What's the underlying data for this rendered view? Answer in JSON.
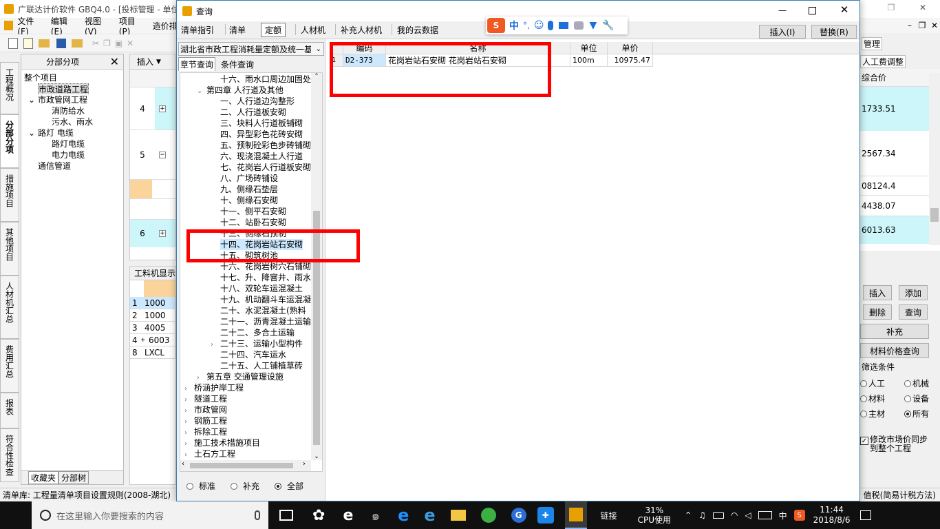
{
  "bg_app": {
    "title": "广联达计价软件 GBQ4.0 - [投标管理 - 单位",
    "menu": [
      "文件(F)",
      "编辑(E)",
      "视图(V)",
      "项目(P)",
      "造价排"
    ],
    "toolbar_insert": "插入",
    "sidebar_tabs": [
      "工程概况",
      "分部分项",
      "措施项目",
      "其他项目",
      "人材机汇总",
      "费用汇总",
      "报表",
      "符合性检查"
    ],
    "left_panel": {
      "title": "分部分项",
      "tree": [
        "整个项目",
        "市政道路工程",
        "市政管网工程",
        "消防给水",
        "污水、雨水",
        "路灯 电缆",
        "路灯电缆",
        "电力电缆",
        "通信管道"
      ],
      "tabs": [
        "收藏夹",
        "分部树"
      ]
    },
    "main_rows": [
      "4",
      "5",
      "6"
    ],
    "bottom_tab": "工料机显示",
    "bottom_rows": [
      {
        "n": "1",
        "code": "1000"
      },
      {
        "n": "2",
        "code": "1000"
      },
      {
        "n": "3",
        "code": "4005"
      },
      {
        "n": "4",
        "code": "6003"
      },
      {
        "n": "8",
        "code": "LXCL"
      }
    ],
    "right_panel": {
      "label_manage": "管理",
      "label_labor": "人工费调整",
      "col_header": "综合价",
      "values": [
        "1733.51",
        "2567.34",
        "08124.4",
        "4438.07",
        "6013.63"
      ],
      "buttons": [
        "插入",
        "添加",
        "删除",
        "查询",
        "补充",
        "材料价格查询"
      ],
      "filter_title": "筛选条件",
      "filters": [
        "人工",
        "机械",
        "材料",
        "设备",
        "主材",
        "所有"
      ],
      "sync_label": "修改市场价同步到整个工程"
    },
    "status_left": "清单库: 工程量清单项目设置规则(2008-湖北)",
    "status_right": "值税(简易计税方法)"
  },
  "dialog": {
    "title": "查询",
    "tabs": [
      "清单指引",
      "清单",
      "定额",
      "人材机",
      "补充人材机",
      "我的云数据"
    ],
    "active_tab": "定额",
    "insert_btn": "插入(I)",
    "replace_btn": "替换(R)",
    "library": "湖北省市政工程消耗量定额及统一基",
    "sub_tabs": [
      "章节查询",
      "条件查询"
    ],
    "tree": [
      {
        "level": 2,
        "text": "十六、雨水口周边加固处",
        "arrow": ""
      },
      {
        "level": 1,
        "text": "第四章 人行道及其他",
        "arrow": "down"
      },
      {
        "level": 2,
        "text": "一、人行道边沟整形",
        "arrow": ""
      },
      {
        "level": 2,
        "text": "二、人行道板安砌",
        "arrow": ""
      },
      {
        "level": 2,
        "text": "三、块料人行道板铺砌",
        "arrow": ""
      },
      {
        "level": 2,
        "text": "四、异型彩色花砖安砌",
        "arrow": ""
      },
      {
        "level": 2,
        "text": "五、预制砼彩色步砖铺砌",
        "arrow": ""
      },
      {
        "level": 2,
        "text": "六、现浇混凝土人行道",
        "arrow": ""
      },
      {
        "level": 2,
        "text": "七、花岗岩人行道板安砌",
        "arrow": ""
      },
      {
        "level": 2,
        "text": "八、广场砖铺设",
        "arrow": ""
      },
      {
        "level": 2,
        "text": "九、侧缘石垫层",
        "arrow": ""
      },
      {
        "level": 2,
        "text": "十、侧缘石安砌",
        "arrow": ""
      },
      {
        "level": 2,
        "text": "十一、侧平石安砌",
        "arrow": ""
      },
      {
        "level": 2,
        "text": "十二、站卧石安砌",
        "arrow": ""
      },
      {
        "level": 2,
        "text": "十三、侧缘石预制",
        "arrow": ""
      },
      {
        "level": 2,
        "text": "十四、花岗岩站石安砌",
        "arrow": "",
        "selected": true
      },
      {
        "level": 2,
        "text": "十五、砌筑树池",
        "arrow": ""
      },
      {
        "level": 2,
        "text": "十六、花岗岩树穴石铺砌",
        "arrow": ""
      },
      {
        "level": 2,
        "text": "十七、升、降窨井、雨水",
        "arrow": ""
      },
      {
        "level": 2,
        "text": "十八、双轮车运混凝土",
        "arrow": ""
      },
      {
        "level": 2,
        "text": "十九、机动翻斗车运混凝",
        "arrow": ""
      },
      {
        "level": 2,
        "text": "二十、水泥混凝土(熟料",
        "arrow": ""
      },
      {
        "level": 2,
        "text": "二十一、沥青混凝土运输",
        "arrow": ""
      },
      {
        "level": 2,
        "text": "二十二、多合土运输",
        "arrow": ""
      },
      {
        "level": 2,
        "text": "二十三、运输小型构件",
        "arrow": "right"
      },
      {
        "level": 2,
        "text": "二十四、汽车运水",
        "arrow": ""
      },
      {
        "level": 2,
        "text": "二十五、人工铺植草砖",
        "arrow": ""
      },
      {
        "level": 1,
        "text": "第五章 交通管理设施",
        "arrow": "right"
      },
      {
        "level": 0,
        "text": "桥涵护岸工程",
        "arrow": "right"
      },
      {
        "level": 0,
        "text": "隧道工程",
        "arrow": "right"
      },
      {
        "level": 0,
        "text": "市政管网",
        "arrow": "right"
      },
      {
        "level": 0,
        "text": "钢筋工程",
        "arrow": "right"
      },
      {
        "level": 0,
        "text": "拆除工程",
        "arrow": "right"
      },
      {
        "level": 0,
        "text": "施工技术措施项目",
        "arrow": "right"
      },
      {
        "level": 0,
        "text": "土石方工程",
        "arrow": "right"
      }
    ],
    "radios": [
      "标准",
      "补充",
      "全部"
    ],
    "radio_selected": "全部",
    "table": {
      "headers": [
        "编码",
        "名称",
        "单位",
        "单价"
      ],
      "rows": [
        {
          "n": "1",
          "code": "D2-373",
          "name": "花岗岩站石安砌 花岗岩站石安砌",
          "unit": "100m",
          "price": "10975.47"
        }
      ]
    }
  },
  "ime_bar": {
    "lang": "中"
  },
  "taskbar": {
    "search_placeholder": "在这里输入你要搜索的内容",
    "link_label": "链接",
    "cpu_percent": "31%",
    "cpu_label": "CPU使用",
    "ime": "中",
    "time": "11:44",
    "date": "2018/8/6"
  },
  "colors": {
    "highlight": "#ff0000",
    "accent": "#0078d7",
    "cyan": "#ccf6f9",
    "orange": "#fbd49b"
  }
}
